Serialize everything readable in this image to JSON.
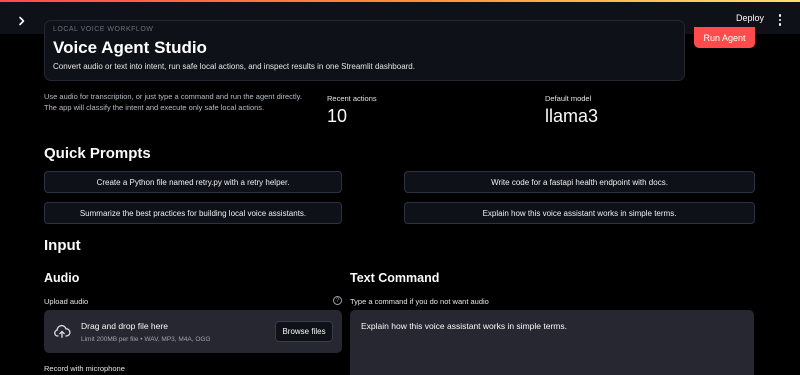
{
  "header": {
    "deploy_label": "Deploy"
  },
  "hero": {
    "eyebrow": "LOCAL VOICE WORKFLOW",
    "title": "Voice Agent Studio",
    "subtitle": "Convert audio or text into intent, run safe local actions, and inspect results in one Streamlit dashboard.",
    "run_label": "Run Agent"
  },
  "intro": "Use audio for transcription, or just type a command and run the agent directly. The app will classify the intent and execute only safe local actions.",
  "metrics": [
    {
      "label": "Recent actions",
      "value": "10"
    },
    {
      "label": "Default model",
      "value": "llama3"
    }
  ],
  "quick_prompts": {
    "title": "Quick Prompts",
    "items": [
      "Create a Python file named retry.py with a retry helper.",
      "Write code for a fastapi health endpoint with docs.",
      "Summarize the best practices for building local voice assistants.",
      "Explain how this voice assistant works in simple terms."
    ]
  },
  "input": {
    "title": "Input",
    "audio": {
      "title": "Audio",
      "upload_label": "Upload audio",
      "help": "?",
      "drop_title": "Drag and drop file here",
      "drop_limit": "Limit 200MB per file • WAV, MP3, M4A, OGG",
      "browse_label": "Browse files",
      "record_label": "Record with microphone"
    },
    "text": {
      "title": "Text Command",
      "label": "Type a command if you do not want audio",
      "value": "Explain how this voice assistant works in simple terms."
    }
  },
  "colors": {
    "accent": "#ff4b4b",
    "background": "#000000",
    "surface": "#0e1117",
    "input_bg": "#262730"
  },
  "icons": {
    "sidebar_toggle": "chevron-right-icon",
    "menu": "more-vertical-icon",
    "upload": "cloud-upload-icon",
    "help": "help-circle-icon"
  }
}
